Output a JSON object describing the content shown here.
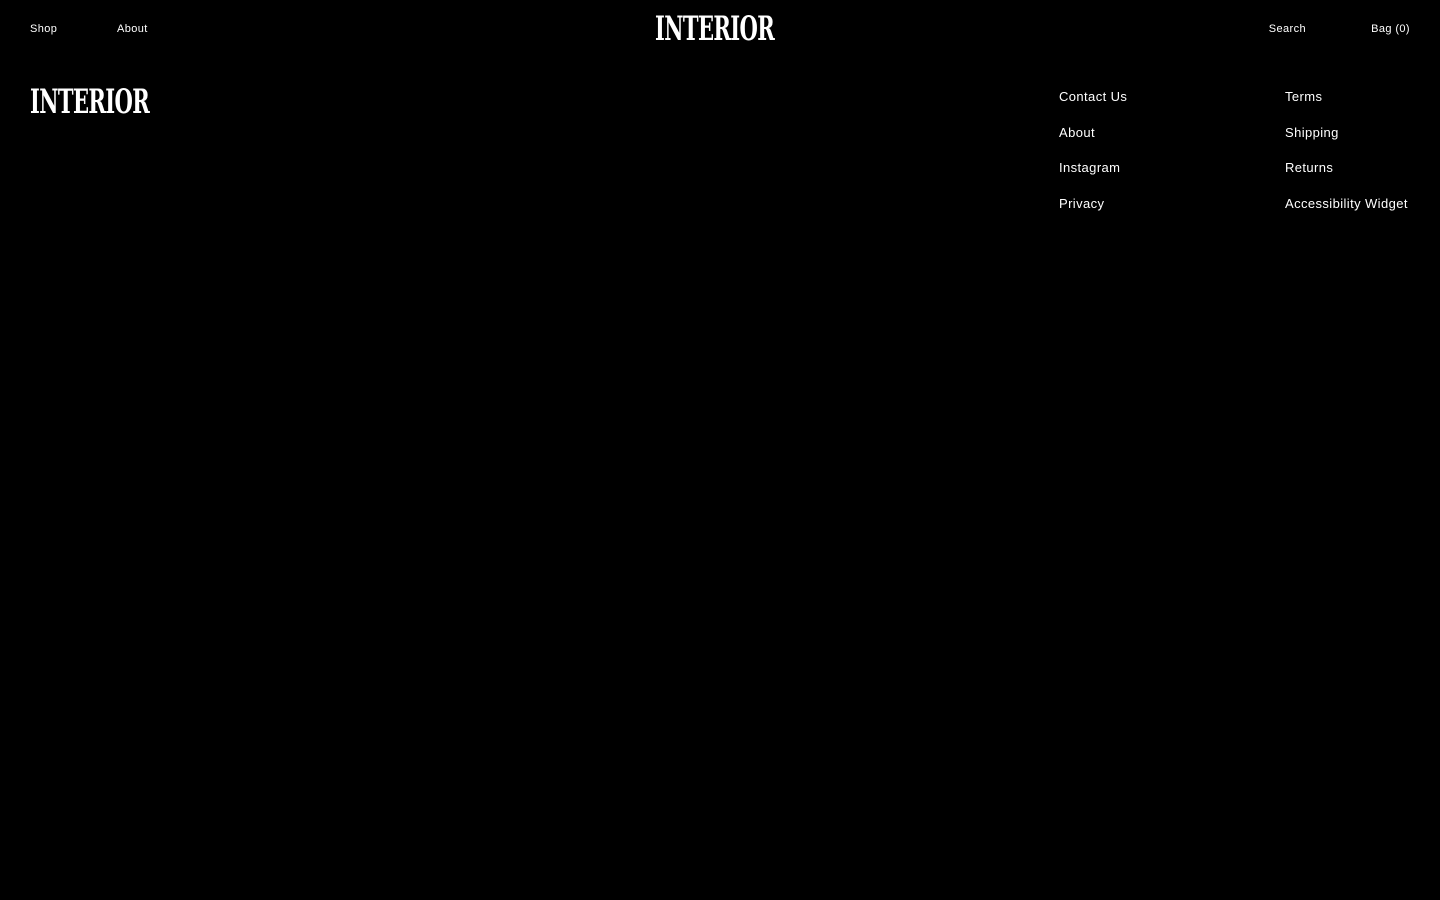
{
  "header": {
    "nav_left": [
      "Shop",
      "About"
    ],
    "logo": "INTERIOR",
    "search_label": "Search",
    "bag_label": "Bag (0)"
  },
  "footer": {
    "logo": "INTERIOR",
    "column_1": [
      "Contact Us",
      "About",
      "Instagram",
      "Privacy"
    ],
    "column_2": [
      "Terms",
      "Shipping",
      "Returns",
      "Accessibility Widget"
    ]
  },
  "colors": {
    "background": "#000000",
    "text": "#ffffff"
  }
}
